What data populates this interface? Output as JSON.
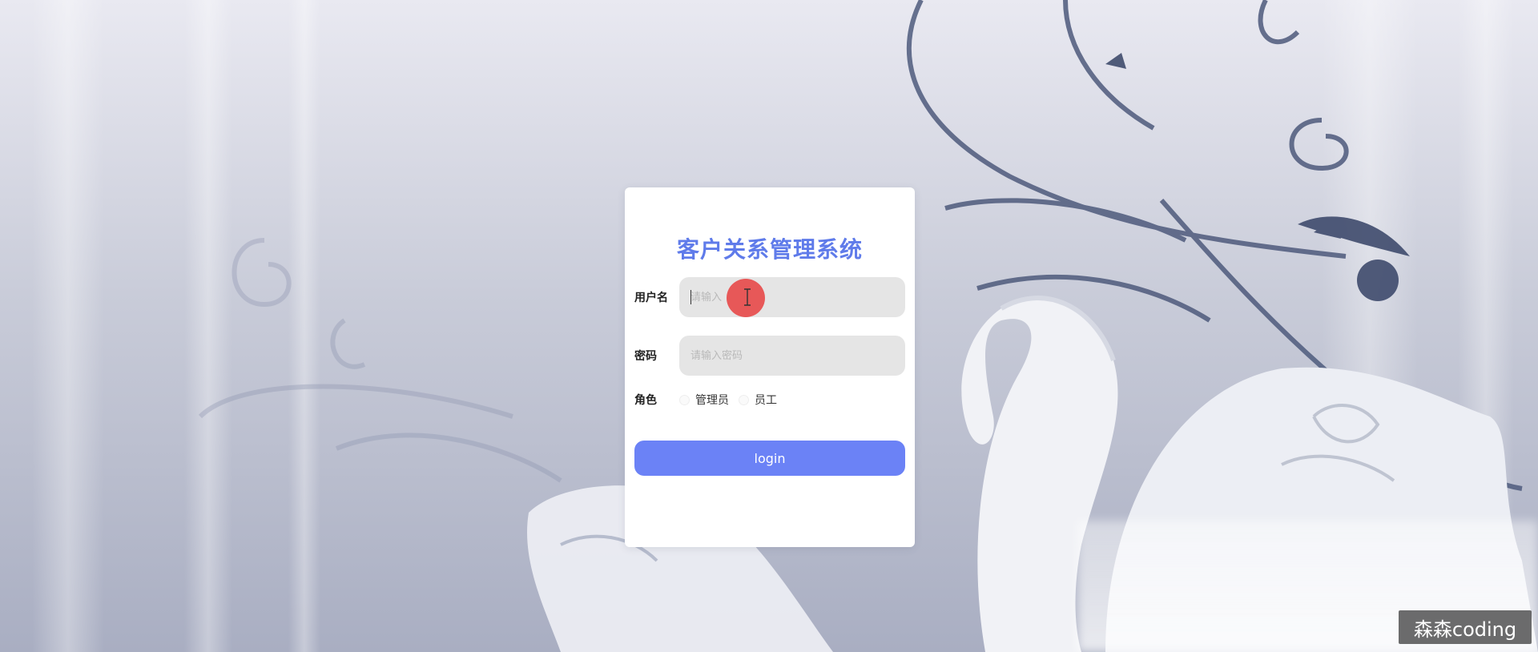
{
  "app": {
    "title": "客户关系管理系统"
  },
  "form": {
    "username_label": "用户名",
    "username_placeholder": "请输入",
    "username_value": "",
    "password_label": "密码",
    "password_placeholder": "请输入密码",
    "password_value": "",
    "role_label": "角色",
    "role_options": [
      "管理员",
      "员工"
    ],
    "submit_label": "login"
  },
  "watermark": {
    "text": "森森coding"
  },
  "colors": {
    "title": "#5f7bea",
    "button": "#6b82f6",
    "input_bg": "#e5e5e5"
  }
}
